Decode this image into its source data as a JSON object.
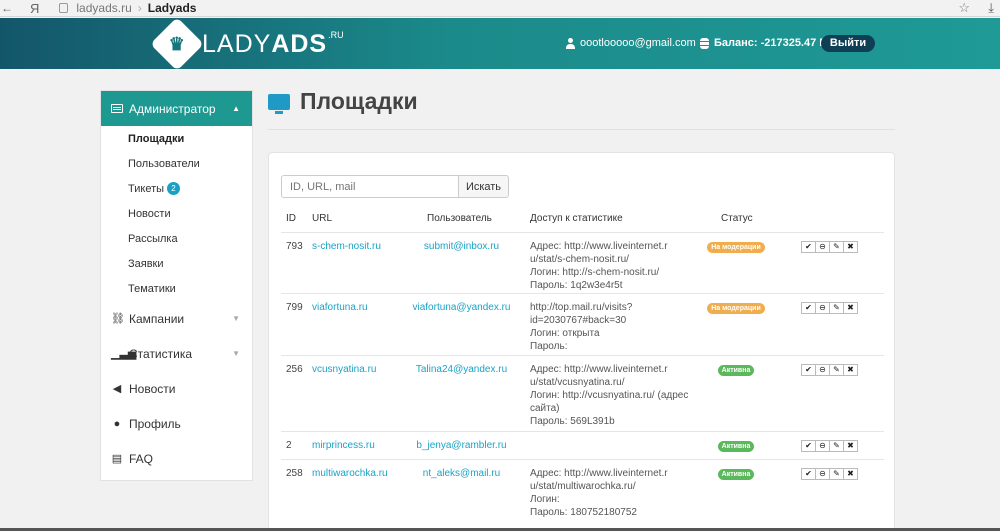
{
  "browser": {
    "yandex_glyph": "Я",
    "url": "ladyads.ru",
    "separator": "›",
    "title": "Ladyads"
  },
  "header": {
    "logo_lady": "LADY",
    "logo_ads": "ADS",
    "logo_ru": ".RU",
    "email": "oootlooooo@gmail.com",
    "balance_label": "Баланс:",
    "balance_value": "-217325.47 Р",
    "logout_label": "Выйти"
  },
  "sidebar": {
    "admin_label": "Администратор",
    "sub_items": [
      {
        "label": "Площадки",
        "active": true
      },
      {
        "label": "Пользователи"
      },
      {
        "label": "Тикеты",
        "badge": "2"
      },
      {
        "label": "Новости"
      },
      {
        "label": "Рассылка"
      },
      {
        "label": "Заявки"
      },
      {
        "label": "Тематики"
      }
    ],
    "items": [
      {
        "label": "Кампании",
        "icon": "sitemap-icon",
        "has_chevron": true
      },
      {
        "label": "Статистика",
        "icon": "bar-chart-icon",
        "has_chevron": true
      },
      {
        "label": "Новости",
        "icon": "volume-icon"
      },
      {
        "label": "Профиль",
        "icon": "user-icon"
      },
      {
        "label": "FAQ",
        "icon": "book-icon"
      }
    ]
  },
  "main": {
    "title": "Площадки",
    "search": {
      "placeholder": "ID, URL, mail",
      "button_label": "Искать"
    },
    "table": {
      "headers": {
        "id": "ID",
        "url": "URL",
        "user": "Пользователь",
        "stats": "Доступ к статистике",
        "status": "Статус"
      },
      "rows": [
        {
          "id": "793",
          "url": "s-chem-nosit.ru",
          "user": "submit@inbox.ru",
          "stats": [
            "Адрес: http://www.liveinternet.r",
            "u/stat/s-chem-nosit.ru/",
            "Логин: http://s-chem-nosit.ru/",
            "Пароль: 1q2w3e4r5t"
          ],
          "status": "На модерации",
          "status_type": "mod"
        },
        {
          "id": "799",
          "url": "viafortuna.ru",
          "user": "viafortuna@yandex.ru",
          "stats": [
            "http://top.mail.ru/visits?",
            "id=2030767#back=30",
            "Логин: открыта",
            "Пароль:"
          ],
          "status": "На модерации",
          "status_type": "mod"
        },
        {
          "id": "256",
          "url": "vcusnyatina.ru",
          "user": "Talina24@yandex.ru",
          "stats": [
            "Адрес: http://www.liveinternet.r",
            "u/stat/vcusnyatina.ru/",
            "Логин: http://vcusnyatina.ru/ (адрес",
            "сайта)",
            "Пароль: 569L391b"
          ],
          "status": "Активна",
          "status_type": "act"
        },
        {
          "id": "2",
          "url": "mirprincess.ru",
          "user": "b_jenya@rambler.ru",
          "stats": [],
          "status": "Активна",
          "status_type": "act"
        },
        {
          "id": "258",
          "url": "multiwarochka.ru",
          "user": "nt_aleks@mail.ru",
          "stats": [
            "Адрес: http://www.liveinternet.r",
            "u/stat/multiwarochka.ru/",
            "Логин:",
            "Пароль: 180752180752"
          ],
          "status": "Активна",
          "status_type": "act"
        }
      ],
      "action_glyphs": {
        "approve": "✔",
        "block": "⊖",
        "edit": "✎",
        "delete": "✖"
      }
    }
  },
  "colors": {
    "accent": "#1e9991",
    "link": "#1aa3c6",
    "moderation": "#f0ad4e",
    "active": "#5cb85c",
    "logout_bg": "#0f3f55"
  }
}
